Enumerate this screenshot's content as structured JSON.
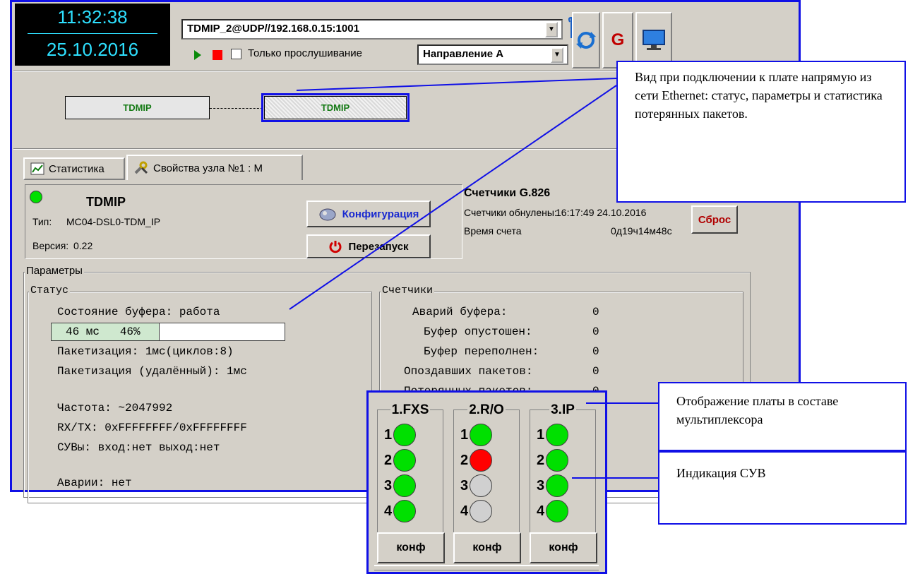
{
  "clock": {
    "time": "11:32:38",
    "date": "25.10.2016"
  },
  "toolbar": {
    "connection_value": "TDMIP_2@UDP//192.168.0.15:1001",
    "listen_only_label": "Только прослушивание",
    "direction_value": "Направление А",
    "g_label": "G"
  },
  "topology": {
    "node_left": "TDMIP",
    "node_right": "TDMIP"
  },
  "tabs": [
    {
      "label": "Статистика"
    },
    {
      "label": "Свойства узла №1 : М"
    }
  ],
  "device": {
    "name": "TDMIP",
    "type_label": "Тип:",
    "type_value": "MC04-DSL0-TDM_IP",
    "version_label": "Версия:",
    "version_value": "0.22",
    "config_button": "Конфигурация",
    "restart_button": "Перезапуск"
  },
  "counters_g826": {
    "title": "Счетчики G.826",
    "reset_label": "Счетчики обнулены:",
    "reset_value": "16:17:49 24.10.2016",
    "time_label": "Время счета",
    "time_value": "0д19ч14м48с",
    "reset_button": "Сброс"
  },
  "params": {
    "title": "Параметры",
    "status": {
      "title": "Статус",
      "buffer_state": "Состояние буфера: работа",
      "buffer_bar_text": "46 мс   46%",
      "buffer_fill": 0.46,
      "packetization": "Пакетизация: 1мс(циклов:8)",
      "packetization_remote": "Пакетизация (удалённый): 1мс",
      "frequency": "Частота: ~2047992",
      "rxtx": "RX/TX: 0xFFFFFFFF/0xFFFFFFFF",
      "signaling": "СУВы: вход:нет выход:нет",
      "alarms": "Аварии: нет"
    },
    "counters": {
      "title": "Счетчики",
      "rows": [
        {
          "label": "Аварий буфера:",
          "value": "0"
        },
        {
          "label": "Буфер опустошен:",
          "value": "0"
        },
        {
          "label": "Буфер переполнен:",
          "value": "0"
        },
        {
          "label": "Опоздавших пакетов:",
          "value": "0"
        },
        {
          "label": "Потерянных пакетов:",
          "value": "0"
        }
      ]
    }
  },
  "mux": {
    "slots": [
      {
        "title": "1.FXS",
        "button": "конф",
        "leds": [
          {
            "num": "1",
            "color": "#00e000"
          },
          {
            "num": "2",
            "color": "#00e000"
          },
          {
            "num": "3",
            "color": "#00e000"
          },
          {
            "num": "4",
            "color": "#00e000"
          }
        ]
      },
      {
        "title": "2.R/O",
        "button": "конф",
        "leds": [
          {
            "num": "1",
            "color": "#00e000"
          },
          {
            "num": "2",
            "color": "#ff0000"
          },
          {
            "num": "3",
            "color": "#d0d0d0"
          },
          {
            "num": "4",
            "color": "#d0d0d0"
          }
        ]
      },
      {
        "title": "3.IP",
        "button": "конф",
        "leds": [
          {
            "num": "1",
            "color": "#00e000"
          },
          {
            "num": "2",
            "color": "#00e000"
          },
          {
            "num": "3",
            "color": "#00e000"
          },
          {
            "num": "4",
            "color": "#00e000"
          }
        ]
      }
    ]
  },
  "callouts": {
    "ethernet": "Вид при подключении к плате напрямую из сети Ethernet: статус, параметры  и статистика потерянных пакетов.",
    "mux_view": "Отображение платы в составе мультиплексора",
    "signaling": "Индикация СУВ"
  },
  "colors": {
    "accent": "#1010e6",
    "led_green": "#00e000",
    "led_red": "#ff0000",
    "led_off": "#d0d0d0",
    "clock_text": "#2ee0ff"
  }
}
